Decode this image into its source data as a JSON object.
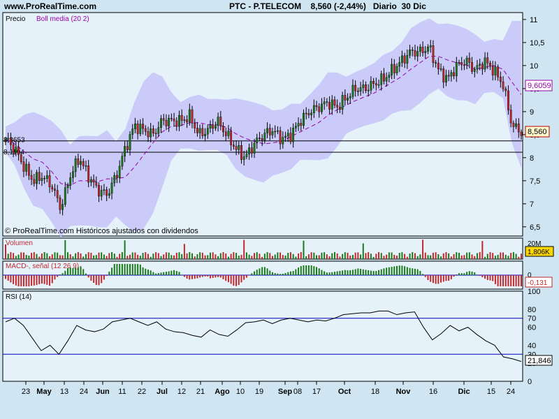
{
  "header": {
    "site": "www.ProRealTime.com",
    "title": "PTC - P.TELECOM    8,560 (-2,44%)   Diario  30 Dic"
  },
  "colors": {
    "background": "#cfe6f2",
    "panel": "#e6f2fa",
    "band": "#c8c8f8",
    "up": "#1a7a1a",
    "down": "#c0282c",
    "mid_line": "#9900aa"
  },
  "price_panel": {
    "label": "Precio",
    "indicator_label": "Boll media (20 2)",
    "footer": "© ProRealTime.com Históricos ajustados con dividendos",
    "y_ticks": [
      "11",
      "10,5",
      "10",
      "9,5",
      "9",
      "8,5",
      "8",
      "7,5",
      "7",
      "6,5"
    ],
    "last_price": "8,560",
    "boll_mid_value": "9,6059",
    "hline_labels": [
      "8,3653",
      "8,1194"
    ]
  },
  "volume_panel": {
    "label": "Volumen",
    "max_tick": "20M",
    "last_value": "1,806K"
  },
  "macd_panel": {
    "label": "MACD-, señal (12 26 9)",
    "zero_tick": "0",
    "last_value": "-0,131"
  },
  "rsi_panel": {
    "label": "RSI (14)",
    "y_ticks": [
      "100",
      "80",
      "70",
      "60",
      "40",
      "30",
      "20",
      "0"
    ],
    "last_value": "21,846"
  },
  "x_axis": {
    "labels": [
      "23",
      "May",
      "13",
      "24",
      "Jun",
      "11",
      "22",
      "Jul",
      "12",
      "21",
      "Ago",
      "10",
      "19",
      "Sep",
      "08",
      "17",
      "Oct",
      "18",
      "Nov",
      "16",
      "Dic",
      "15",
      "24"
    ]
  },
  "chart_data": {
    "type": "candlestick",
    "title": "PTC - P.TELECOM",
    "period": "Diario",
    "last_close": 8.56,
    "change_pct": -2.44,
    "price_ylim": [
      6.3,
      11.15
    ],
    "price_grid": [
      6.5,
      7,
      7.5,
      8,
      8.5,
      9,
      9.5,
      10,
      10.5,
      11
    ],
    "support_lines": [
      8.3653,
      8.1194
    ],
    "closes": [
      8.4,
      8.2,
      7.8,
      7.5,
      7.6,
      7.4,
      6.9,
      7.6,
      8.0,
      7.6,
      7.3,
      7.2,
      7.6,
      8.2,
      8.7,
      8.6,
      8.5,
      8.8,
      8.8,
      8.8,
      8.9,
      8.5,
      8.6,
      8.8,
      8.5,
      8.2,
      8.0,
      8.3,
      8.5,
      8.6,
      8.4,
      8.5,
      8.8,
      9.0,
      9.1,
      9.2,
      9.1,
      9.3,
      9.5,
      9.5,
      9.6,
      9.7,
      9.9,
      10.1,
      10.3,
      10.3,
      10.4,
      9.9,
      9.7,
      10.0,
      10.1,
      9.9,
      10.1,
      9.9,
      9.6,
      8.7,
      8.56
    ],
    "boll_mid_end": 9.6059,
    "volume_ylim": [
      0,
      20
    ],
    "volume_unit": "M",
    "macd_last": -0.131,
    "rsi_ylim": [
      0,
      100
    ],
    "rsi_levels": [
      70,
      30
    ],
    "rsi_last": 21.846,
    "rsi": [
      66,
      70,
      62,
      48,
      34,
      40,
      30,
      45,
      62,
      57,
      55,
      58,
      66,
      68,
      70,
      66,
      62,
      66,
      58,
      55,
      54,
      51,
      49,
      57,
      52,
      50,
      57,
      65,
      66,
      68,
      64,
      68,
      70,
      68,
      66,
      68,
      67,
      70,
      74,
      75,
      76,
      76,
      78,
      78,
      74,
      76,
      77,
      60,
      46,
      53,
      62,
      56,
      60,
      52,
      45,
      40,
      27,
      25,
      22
    ]
  }
}
